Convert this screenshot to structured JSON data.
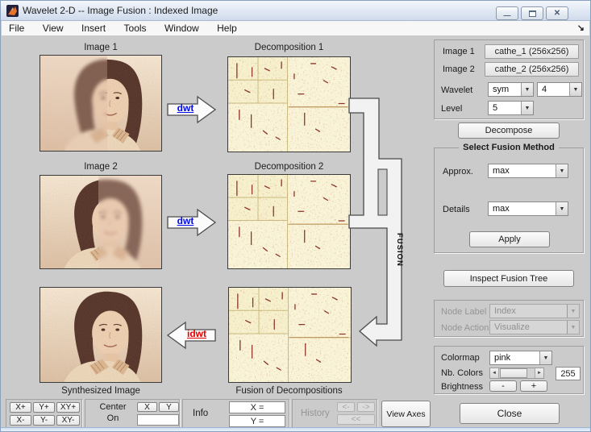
{
  "window": {
    "title": "Wavelet 2-D -- Image Fusion : Indexed Image"
  },
  "menu": {
    "items": [
      "File",
      "View",
      "Insert",
      "Tools",
      "Window",
      "Help"
    ]
  },
  "canvas": {
    "image1_label": "Image 1",
    "decomp1_label": "Decomposition 1",
    "image2_label": "Image 2",
    "decomp2_label": "Decomposition 2",
    "synth_label": "Synthesized Image",
    "fusion_label": "Fusion of Decompositions",
    "dwt_label": "dwt",
    "idwt_label": "idwt",
    "fusion_arrow_label": "FUSION"
  },
  "panel": {
    "image1_label": "Image 1",
    "image1_value": "cathe_1 (256x256)",
    "image2_label": "Image 2",
    "image2_value": "cathe_2 (256x256)",
    "wavelet_label": "Wavelet",
    "wavelet_family": "sym",
    "wavelet_number": "4",
    "level_label": "Level",
    "level_value": "5",
    "decompose_label": "Decompose",
    "fusion_group_title": "Select Fusion Method",
    "approx_label": "Approx.",
    "approx_value": "max",
    "details_label": "Details",
    "details_value": "max",
    "apply_label": "Apply",
    "inspect_label": "Inspect Fusion Tree",
    "node_label_label": "Node Label",
    "node_label_value": "Index",
    "node_action_label": "Node Action",
    "node_action_value": "Visualize",
    "colormap_label": "Colormap",
    "colormap_value": "pink",
    "nb_colors_label": "Nb. Colors",
    "nb_colors_value": "255",
    "brightness_label": "Brightness",
    "brightness_minus": "-",
    "brightness_plus": "+",
    "close_label": "Close"
  },
  "toolbar": {
    "zoom_buttons": [
      "X+",
      "Y+",
      "XY+",
      "X-",
      "Y-",
      "XY-"
    ],
    "center_line1": "Center",
    "center_line2": "On",
    "center_x": "X",
    "center_y": "Y",
    "info_label": "Info",
    "info_x": "X =",
    "info_y": "Y =",
    "history_label": "History",
    "history_back": "<-",
    "history_fwd": "->",
    "history_all": "<<",
    "view_axes_label": "View Axes"
  },
  "icons": {
    "dropdown_arrow": "▼",
    "slider_left": "◄",
    "slider_right": "►",
    "menu_overflow": "↘",
    "minimize": "—",
    "close_x": "✕"
  },
  "colors": {
    "figure_bg": "#cbcbcb",
    "dwt_blue": "#0008e8",
    "idwt_red": "#e00000",
    "decomp_cream": "#f9f4d7",
    "speck_red": "#8a3326"
  }
}
